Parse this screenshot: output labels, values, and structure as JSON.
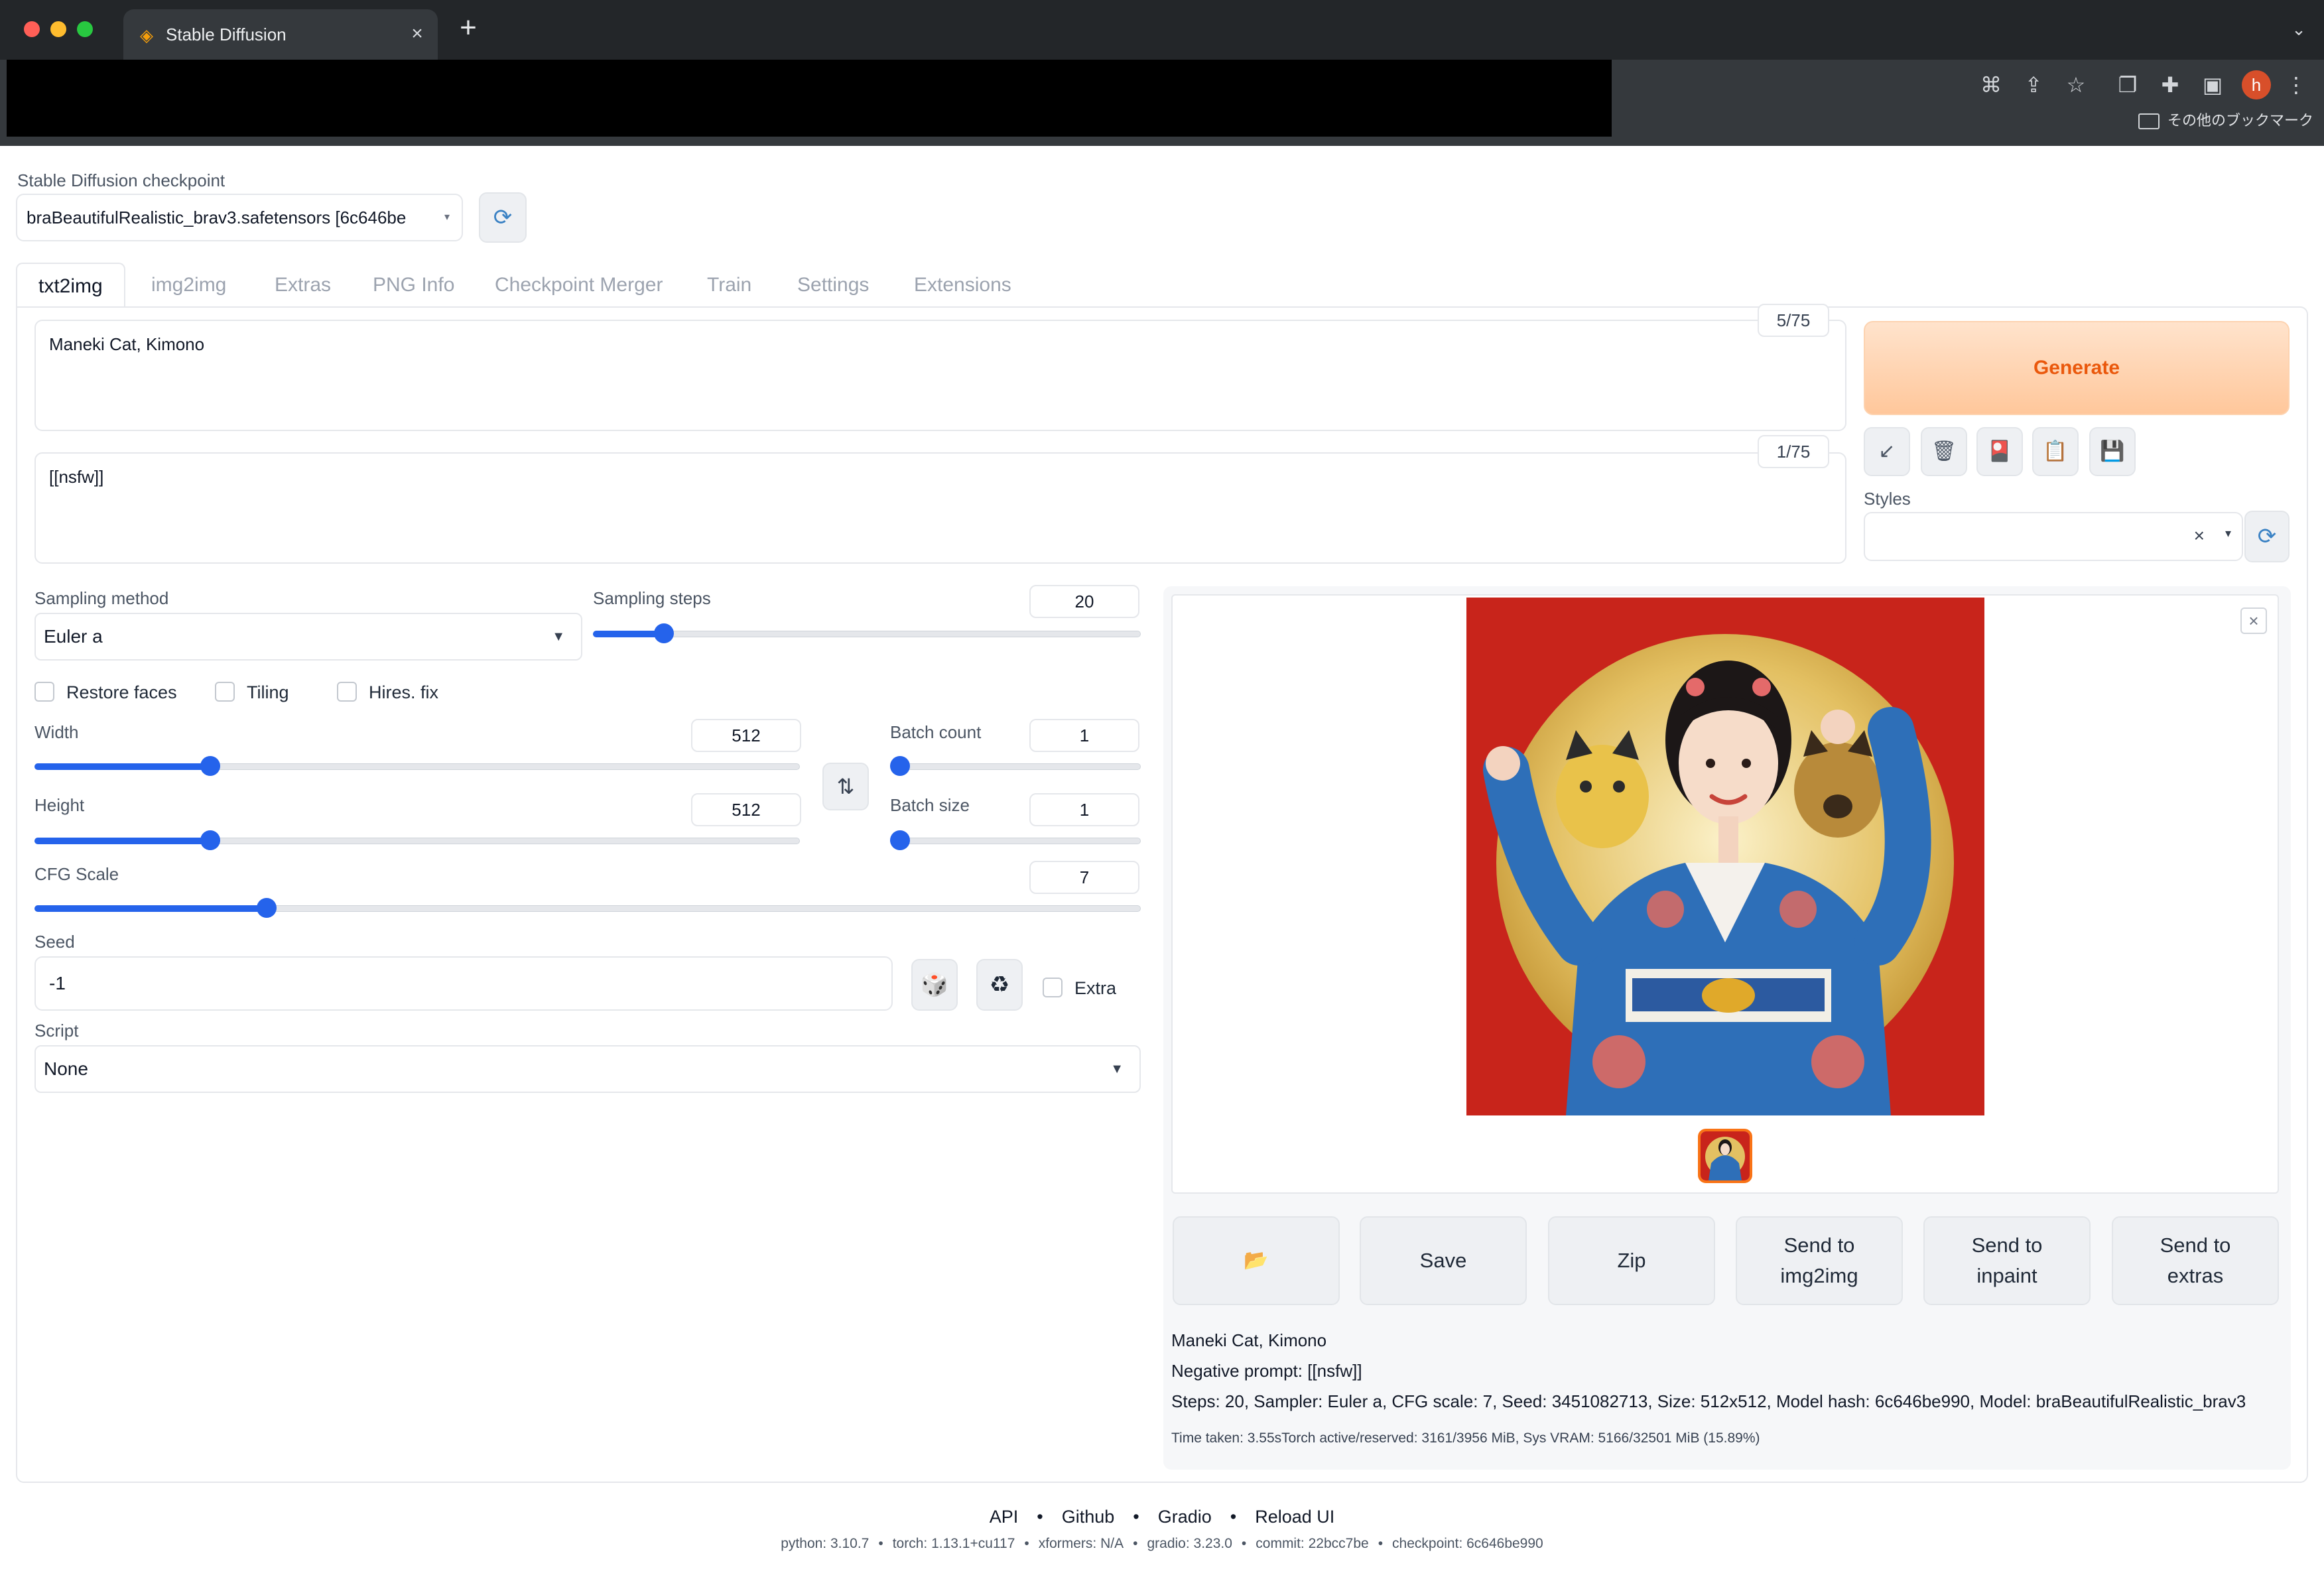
{
  "browser": {
    "tab_title": "Stable Diffusion",
    "bookmarks_label": "その他のブックマーク",
    "profile_initial": "h"
  },
  "checkpoint": {
    "label": "Stable Diffusion checkpoint",
    "value": "braBeautifulRealistic_brav3.safetensors [6c646be"
  },
  "tabs": [
    "txt2img",
    "img2img",
    "Extras",
    "PNG Info",
    "Checkpoint Merger",
    "Train",
    "Settings",
    "Extensions"
  ],
  "prompt": {
    "text": "Maneki Cat, Kimono",
    "counter": "5/75"
  },
  "negative_prompt": {
    "text": "[[nsfw]]",
    "counter": "1/75"
  },
  "generate_label": "Generate",
  "styles_label": "Styles",
  "params": {
    "sampling_method_label": "Sampling method",
    "sampling_method": "Euler a",
    "sampling_steps_label": "Sampling steps",
    "sampling_steps": "20",
    "restore_faces": "Restore faces",
    "tiling": "Tiling",
    "hires_fix": "Hires. fix",
    "width_label": "Width",
    "width": "512",
    "height_label": "Height",
    "height": "512",
    "batch_count_label": "Batch count",
    "batch_count": "1",
    "batch_size_label": "Batch size",
    "batch_size": "1",
    "cfg_label": "CFG Scale",
    "cfg": "7",
    "seed_label": "Seed",
    "seed": "-1",
    "extra_label": "Extra",
    "script_label": "Script",
    "script": "None"
  },
  "slider_levels": {
    "sampling_steps": 0.13,
    "width": 0.23,
    "height": 0.23,
    "batch_count": 0.0,
    "batch_size": 0.0,
    "cfg": 0.21
  },
  "output_buttons": {
    "folder_icon": "folder-icon",
    "save": "Save",
    "zip": "Zip",
    "send_img2img_1": "Send to",
    "send_img2img_2": "img2img",
    "send_inpaint_1": "Send to",
    "send_inpaint_2": "inpaint",
    "send_extras_1": "Send to",
    "send_extras_2": "extras"
  },
  "info": {
    "prompt": "Maneki Cat, Kimono",
    "negative": "Negative prompt: [[nsfw]]",
    "params": "Steps: 20, Sampler: Euler a, CFG scale: 7, Seed: 3451082713, Size: 512x512, Model hash: 6c646be990, Model: braBeautifulRealistic_brav3",
    "time": "Time taken: 3.55sTorch active/reserved: 3161/3956 MiB, Sys VRAM: 5166/32501 MiB (15.89%)"
  },
  "footer": {
    "links": [
      "API",
      "Github",
      "Gradio",
      "Reload UI"
    ],
    "versions": [
      "python: 3.10.7",
      "torch: 1.13.1+cu117",
      "xformers: N/A",
      "gradio: 3.23.0",
      "commit: 22bcc7be",
      "checkpoint: 6c646be990"
    ]
  },
  "colors": {
    "accent": "#2563eb",
    "generate_text": "#ea580c",
    "generate_bg": "#ffc79b"
  }
}
